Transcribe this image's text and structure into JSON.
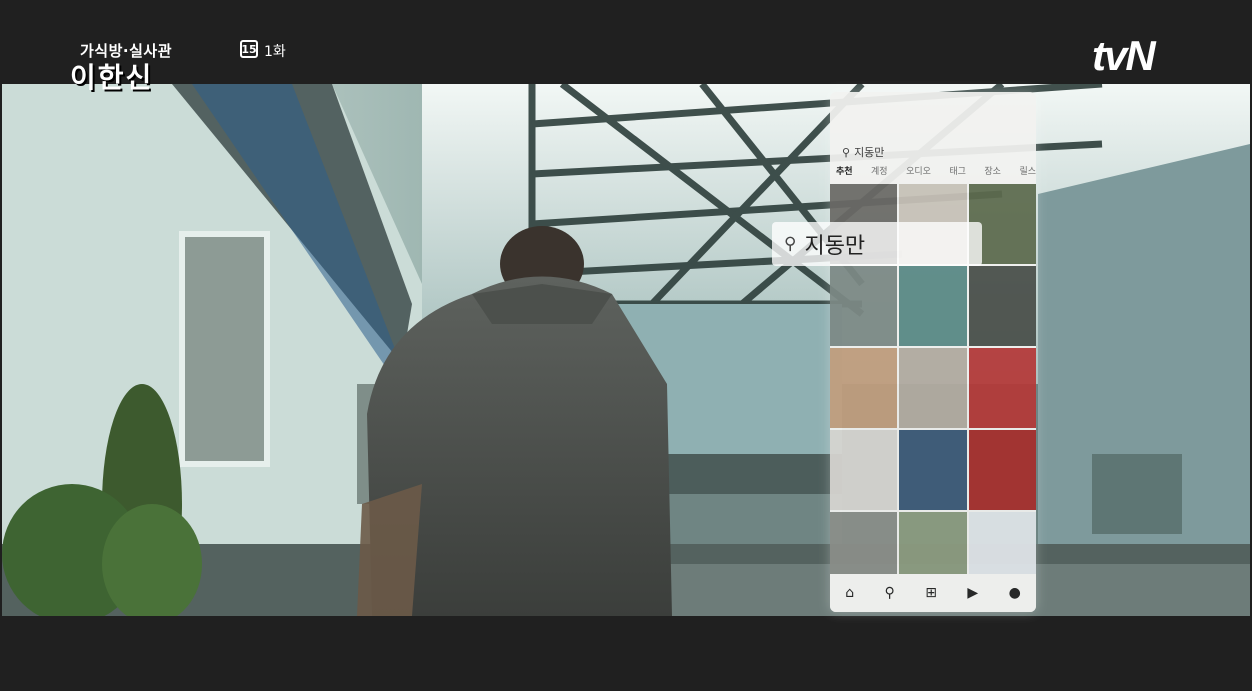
{
  "overlay": {
    "show_subtitle": "가식방·실사관",
    "show_title": "이한신",
    "rating_badge": "15",
    "episode": "1화",
    "network": "tvN"
  },
  "phone": {
    "search_query": "지동만",
    "tabs": [
      "추천",
      "계정",
      "오디오",
      "태그",
      "장소",
      "릴스"
    ],
    "active_tab": "추천",
    "nav_icons": [
      "home-icon",
      "search-icon",
      "add-icon",
      "reels-icon",
      "profile-icon"
    ]
  },
  "floating_search": {
    "query": "지동만"
  }
}
